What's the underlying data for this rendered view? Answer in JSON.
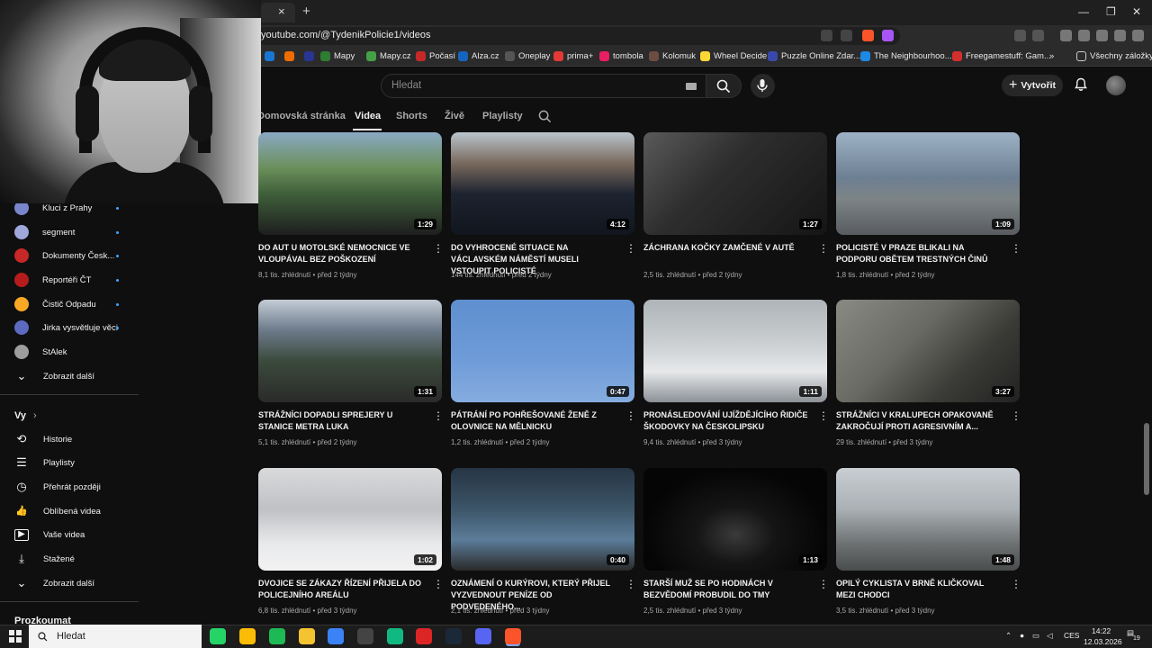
{
  "browser": {
    "tab_close": "×",
    "new_tab": "+",
    "url": "youtube.com/@TydenikPolicie1/videos",
    "window_controls": [
      "—",
      "❐",
      "✕"
    ],
    "bookmarks": [
      {
        "label": "Mapy",
        "color": "#2e7d32"
      },
      {
        "label": "Mapy.cz",
        "color": "#43a047"
      },
      {
        "label": "Počasí",
        "color": "#c62828"
      },
      {
        "label": "Alza.cz",
        "color": "#1565c0"
      },
      {
        "label": "Oneplay",
        "color": "#555555"
      },
      {
        "label": "prima+",
        "color": "#e53935"
      },
      {
        "label": "tombola",
        "color": "#e91e63"
      },
      {
        "label": "Kolomuk",
        "color": "#6d4c41"
      },
      {
        "label": "Wheel Decide",
        "color": "#fdd835"
      },
      {
        "label": "Puzzle Online Zdar...",
        "color": "#3949ab"
      },
      {
        "label": "The Neighbourhoo...",
        "color": "#1e88e5"
      },
      {
        "label": "Freegamestuff: Gam...",
        "color": "#d32f2f"
      }
    ],
    "bookmarks_more": "»",
    "all_bookmarks": "Všechny záložky"
  },
  "header": {
    "search_placeholder": "Hledat",
    "create_label": "Vytvořit"
  },
  "channel_tabs": [
    {
      "label": "Domovská stránka",
      "active": false
    },
    {
      "label": "Videa",
      "active": true
    },
    {
      "label": "Shorts",
      "active": false
    },
    {
      "label": "Živě",
      "active": false
    },
    {
      "label": "Playlisty",
      "active": false
    }
  ],
  "sidebar": {
    "subscriptions": [
      {
        "label": "Kluci z Prahy",
        "color": "#7986cb"
      },
      {
        "label": "segment",
        "color": "#9fa8da"
      },
      {
        "label": "Dokumenty Česk...",
        "color": "#c62828"
      },
      {
        "label": "Reportéři ČT",
        "color": "#b71c1c"
      },
      {
        "label": "Čistič Odpadu",
        "color": "#f9a825"
      },
      {
        "label": "Jirka vysvětluje věci",
        "color": "#5c6bc0"
      },
      {
        "label": "StAlek",
        "color": "#9e9e9e"
      }
    ],
    "show_more_1": "Zobrazit další",
    "you_section": "Vy",
    "you_items": [
      {
        "label": "Historie",
        "icon": "history-icon",
        "glyph": "⟲"
      },
      {
        "label": "Playlisty",
        "icon": "playlist-icon",
        "glyph": "☰"
      },
      {
        "label": "Přehrát později",
        "icon": "clock-icon",
        "glyph": "◷"
      },
      {
        "label": "Oblíbená videa",
        "icon": "thumbs-up-icon",
        "glyph": "👍"
      },
      {
        "label": "Vaše videa",
        "icon": "video-icon",
        "glyph": "▶"
      },
      {
        "label": "Stažené",
        "icon": "download-icon",
        "glyph": "⤓"
      }
    ],
    "show_more_2": "Zobrazit další",
    "explore_section": "Prozkoumat"
  },
  "videos": [
    {
      "title": "DO AUT U MOTOLSKÉ NEMOCNICE VE VLOUPÁVAL BEZ POŠKOZENÍ",
      "views": "8,1 tis. zhlédnutí",
      "age": "před 2 týdny",
      "duration": "1:29",
      "bg": "linear-gradient(180deg,#8aa9c4 0%,#6b8f5b 35%,#3f5f3a 60%,#1e1e1e 100%)"
    },
    {
      "title": "DO VYHROCENÉ SITUACE NA VÁCLAVSKÉM NÁMĚSTÍ MUSELI VSTOUPIT POLICISTÉ",
      "views": "144 tis. zhlédnutí",
      "age": "před 2 týdny",
      "duration": "4:12",
      "bg": "linear-gradient(180deg,#b9c4cc 0%,#7a6a5e 30%,#1d2330 60%,#11151d 100%)"
    },
    {
      "title": "ZÁCHRANA KOČKY ZAMČENÉ V AUTĚ",
      "views": "2,5 tis. zhlédnutí",
      "age": "před 2 týdny",
      "duration": "1:27",
      "bg": "linear-gradient(135deg,#5a5a5a 0%,#2e2e2e 40%,#151515 100%)"
    },
    {
      "title": "POLICISTÉ V PRAZE BLIKALI NA PODPORU OBĚTEM TRESTNÝCH ČINŮ",
      "views": "1,8 tis. zhlédnutí",
      "age": "před 2 týdny",
      "duration": "1:09",
      "bg": "linear-gradient(180deg,#9db2c6 0%,#6d7f92 45%,#7d8486 65%,#585c60 100%)"
    },
    {
      "title": "STRÁŽNÍCI DOPADLI SPREJERY U STANICE METRA LUKA",
      "views": "5,1 tis. zhlédnutí",
      "age": "před 2 týdny",
      "duration": "1:31",
      "bg": "linear-gradient(180deg,#c3ccd6 0%,#6c7a8a 30%,#3b4a3c 60%,#2a2a2a 100%)"
    },
    {
      "title": "PÁTRÁNÍ PO POHŘEŠOVANÉ ŽENĚ Z OLOVNICE NA MĚLNICKU",
      "views": "1,2 tis. zhlédnutí",
      "age": "před 2 týdny",
      "duration": "0:47",
      "bg": "linear-gradient(180deg,#5f8fd0 0%,#6f9cd8 60%,#85acdf 100%)"
    },
    {
      "title": "PRONÁSLEDOVÁNÍ UJÍŽDĚJÍCÍHO ŘIDIČE ŠKODOVKY NA ČESKOLIPSKU",
      "views": "9,4 tis. zhlédnutí",
      "age": "před 3 týdny",
      "duration": "1:11",
      "bg": "linear-gradient(180deg,#aeb4b8 0%,#c9cdcf 40%,#e6e8ea 70%,#8c9196 100%)"
    },
    {
      "title": "STRÁŽNÍCI V KRALUPECH OPAKOVANĚ ZAKROČUJÍ PROTI AGRESIVNÍM A...",
      "views": "29 tis. zhlédnutí",
      "age": "před 3 týdny",
      "duration": "3:27",
      "bg": "linear-gradient(135deg,#8a8a84 0%,#6a6a64 40%,#3a3a36 70%,#222 100%)"
    },
    {
      "title": "DVOJICE SE ZÁKAZY ŘÍZENÍ PŘIJELA DO POLICEJNÍHO AREÁLU",
      "views": "6,8 tis. zhlédnutí",
      "age": "před 3 týdny",
      "duration": "1:02",
      "bg": "linear-gradient(180deg,#d9dadc 0%,#bfc1c4 40%,#e9eaec 75%,#f2f2f2 100%)"
    },
    {
      "title": "OZNÁMENÍ O KURÝROVI, KTERÝ PŘIJEL VYZVEDNOUT PENÍZE OD PODVEDENÉHO...",
      "views": "2,1 tis. zhlédnutí",
      "age": "před 3 týdny",
      "duration": "0:40",
      "bg": "linear-gradient(180deg,#263544 0%,#3c5568 40%,#5b7c99 70%,#2a2a2a 100%)"
    },
    {
      "title": "STARŠÍ MUŽ SE PO HODINÁCH V BEZVĚDOMÍ PROBUDIL DO TMY",
      "views": "2,5 tis. zhlédnutí",
      "age": "před 3 týdny",
      "duration": "1:13",
      "bg": "radial-gradient(ellipse at 50% 65%,#3a3a3a 0%,#151515 30%,#050505 70%)"
    },
    {
      "title": "OPILÝ CYKLISTA V BRNĚ KLIČKOVAL MEZI CHODCI",
      "views": "3,5 tis. zhlédnutí",
      "age": "před 3 týdny",
      "duration": "1:48",
      "bg": "linear-gradient(180deg,#c9ced3 0%,#aab0b4 40%,#6b6f70 75%,#4a4d4e 100%)"
    }
  ],
  "taskbar": {
    "search_label": "Hledat",
    "apps": [
      {
        "name": "whatsapp-icon",
        "color": "#25d366"
      },
      {
        "name": "chrome-icon",
        "color": "#fbbc05"
      },
      {
        "name": "spotify-icon",
        "color": "#1db954"
      },
      {
        "name": "file-explorer-icon",
        "color": "#f4c430"
      },
      {
        "name": "app-m-icon",
        "color": "#3b82f6"
      },
      {
        "name": "app-g-icon",
        "color": "#444444"
      },
      {
        "name": "app-chat-icon",
        "color": "#10b981"
      },
      {
        "name": "app-red-icon",
        "color": "#dc2626"
      },
      {
        "name": "steam-icon",
        "color": "#1b2838"
      },
      {
        "name": "discord-icon",
        "color": "#5865f2"
      },
      {
        "name": "brave-icon",
        "color": "#fb542b"
      }
    ],
    "language": "CES",
    "time": "14:22",
    "date": "12.03.2026",
    "notif_count": "19"
  }
}
